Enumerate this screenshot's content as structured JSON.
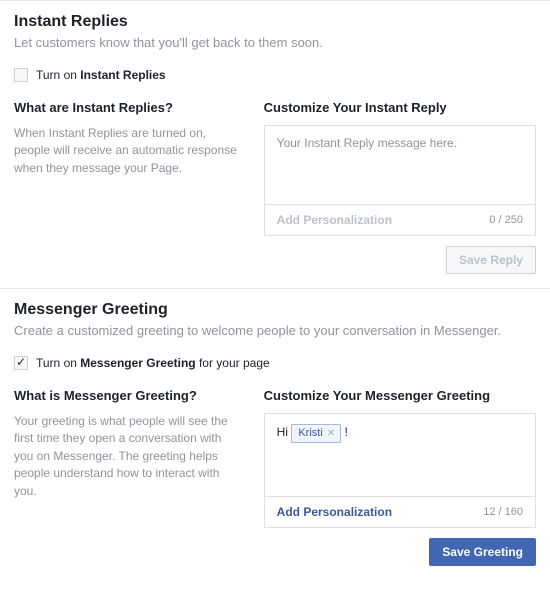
{
  "instantReplies": {
    "title": "Instant Replies",
    "subtitle": "Let customers know that you'll get back to them soon.",
    "checkbox": {
      "prefix": "Turn on ",
      "bold": "Instant Replies",
      "checked": false
    },
    "left": {
      "heading": "What are Instant Replies?",
      "desc": "When Instant Replies are turned on, people will receive an automatic response when they message your Page."
    },
    "right": {
      "heading": "Customize Your Instant Reply",
      "placeholder": "Your Instant Reply message here.",
      "addPersonalization": "Add Personalization",
      "counter": "0 / 250",
      "saveLabel": "Save Reply"
    }
  },
  "messengerGreeting": {
    "title": "Messenger Greeting",
    "subtitle": "Create a customized greeting to welcome people to your conversation in Messenger.",
    "checkbox": {
      "prefix": "Turn on ",
      "bold": "Messenger Greeting",
      "suffix": " for your page",
      "checked": true
    },
    "left": {
      "heading": "What is Messenger Greeting?",
      "desc": "Your greeting is what people will see the first time they open a conversation with you on Messenger. The greeting helps people understand how to interact with you."
    },
    "right": {
      "heading": "Customize Your Messenger Greeting",
      "prefix": "Hi ",
      "chip": "Kristi",
      "suffix": " !",
      "addPersonalization": "Add Personalization",
      "counter": "12 / 160",
      "saveLabel": "Save Greeting"
    }
  }
}
